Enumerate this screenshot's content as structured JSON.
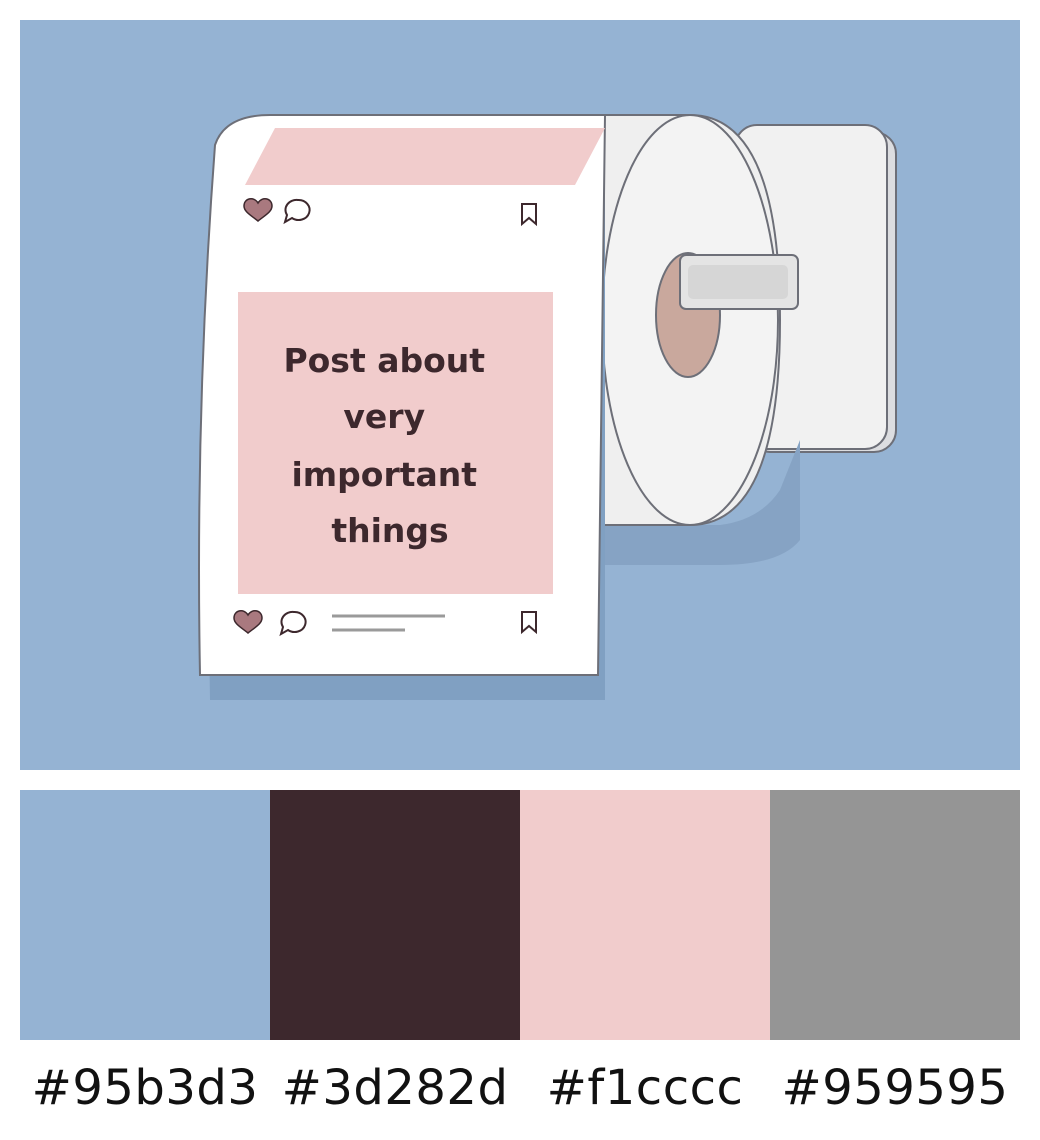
{
  "illustration": {
    "post_text_lines": [
      "Post about",
      "very",
      "important",
      "things"
    ],
    "icons": [
      "heart-icon",
      "comment-icon",
      "bookmark-icon"
    ],
    "colors": {
      "background": "#95b3d3",
      "pink": "#f1cccc",
      "dark": "#3d282d",
      "paper": "#ffffff",
      "roll_side": "#efefef",
      "tube": "#c9a89d",
      "outline": "#6d6f78"
    }
  },
  "palette": [
    {
      "hex": "#95b3d3",
      "label": "#95b3d3"
    },
    {
      "hex": "#3d282d",
      "label": "#3d282d"
    },
    {
      "hex": "#f1cccc",
      "label": "#f1cccc"
    },
    {
      "hex": "#959595",
      "label": "#959595"
    }
  ]
}
